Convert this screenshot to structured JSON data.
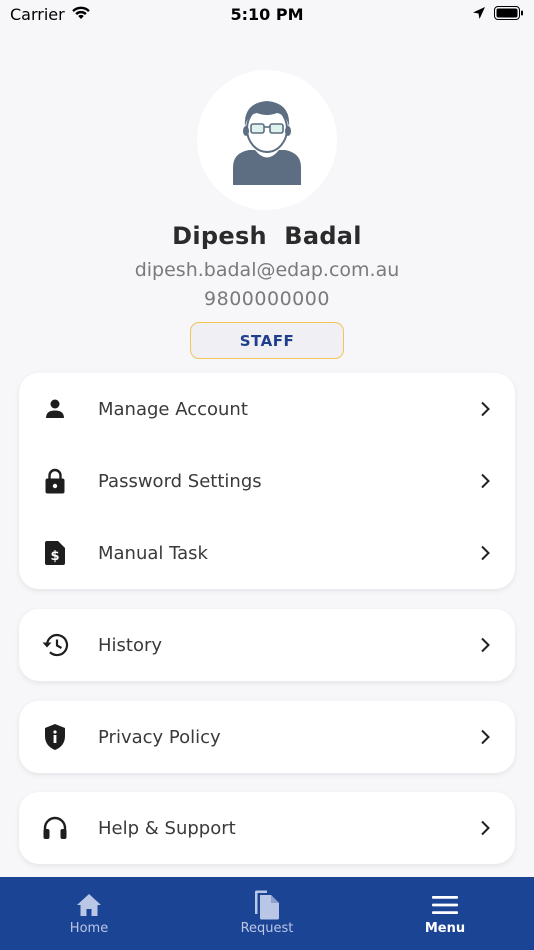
{
  "status_bar": {
    "carrier": "Carrier",
    "time": "5:10 PM"
  },
  "profile": {
    "name": "Dipesh  Badal",
    "email": "dipesh.badal@edap.com.au",
    "phone": "9800000000",
    "role": "STAFF"
  },
  "menu": {
    "group1": [
      {
        "label": "Manage Account",
        "icon": "person-icon"
      },
      {
        "label": "Password Settings",
        "icon": "lock-icon"
      },
      {
        "label": "Manual Task",
        "icon": "document-dollar-icon"
      }
    ],
    "history": {
      "label": "History",
      "icon": "history-icon"
    },
    "privacy": {
      "label": "Privacy Policy",
      "icon": "shield-info-icon"
    },
    "help": {
      "label": "Help & Support",
      "icon": "headset-icon"
    }
  },
  "bottom_nav": {
    "items": [
      {
        "label": "Home",
        "icon": "home-icon",
        "active": false
      },
      {
        "label": "Request",
        "icon": "documents-icon",
        "active": false
      },
      {
        "label": "Menu",
        "icon": "hamburger-menu-icon",
        "active": true
      }
    ]
  },
  "colors": {
    "accent": "#1c4494",
    "badge_border": "#f2c45a",
    "background": "#f7f7fa"
  }
}
